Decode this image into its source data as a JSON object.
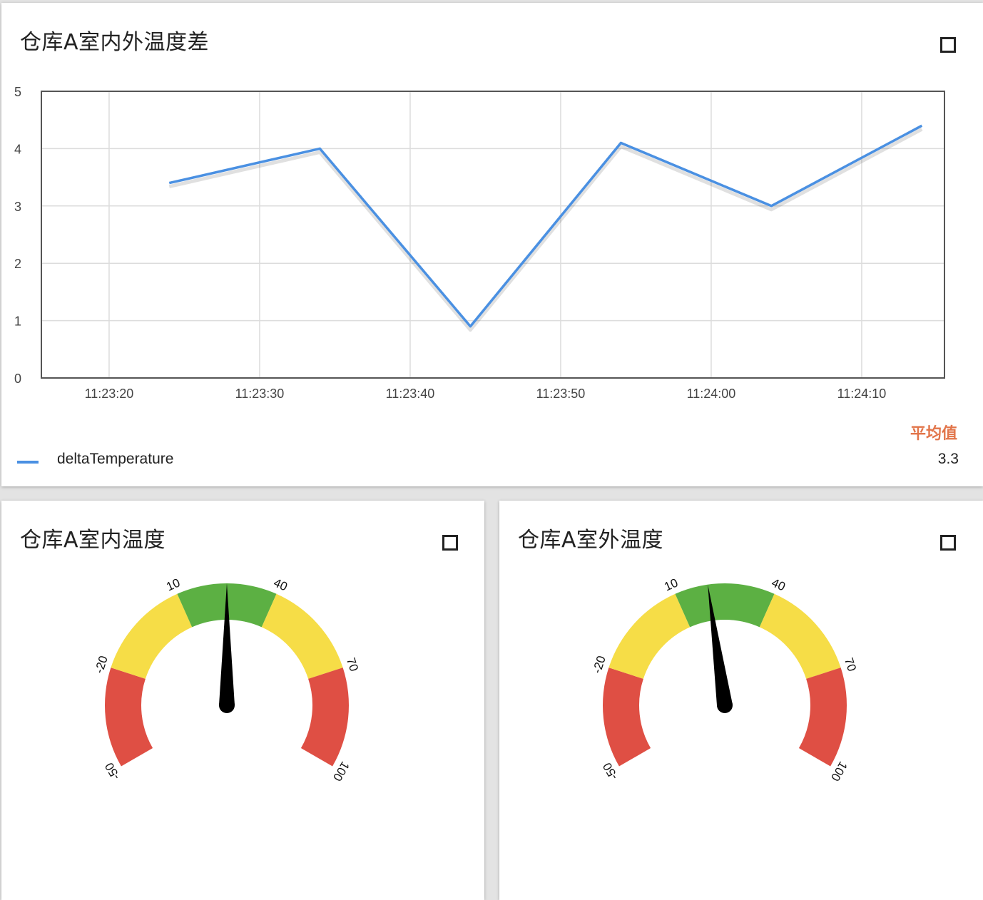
{
  "top_card": {
    "title": "仓库A室内外温度差",
    "fullscreen_icon": "fullscreen-icon",
    "avg_header": "平均值",
    "legend": [
      {
        "label": "deltaTemperature",
        "color": "#4a90e2",
        "avg": "3.3"
      }
    ]
  },
  "chart_data": {
    "type": "line",
    "title": "仓库A室内外温度差",
    "xlabel": "",
    "ylabel": "",
    "ylim": [
      0,
      5
    ],
    "yticks": [
      "0",
      "1",
      "2",
      "3",
      "4",
      "5"
    ],
    "xticks": [
      "11:23:20",
      "11:23:30",
      "11:23:40",
      "11:23:50",
      "11:24:00",
      "11:24:10"
    ],
    "xlim": [
      "11:23:15.5",
      "11:24:15.5"
    ],
    "grid": true,
    "series": [
      {
        "name": "deltaTemperature",
        "color": "#4a90e2",
        "x": [
          "11:23:24",
          "11:23:34",
          "11:23:44",
          "11:23:54",
          "11:24:04",
          "11:24:14"
        ],
        "y": [
          3.4,
          4.0,
          0.9,
          4.1,
          3.0,
          4.4
        ]
      }
    ]
  },
  "gauges": [
    {
      "title": "仓库A室内温度",
      "value": 25,
      "min": -50,
      "max": 100,
      "tick_labels": [
        "-50",
        "-20",
        "10",
        "40",
        "70",
        "100"
      ],
      "bands": [
        {
          "from": -50,
          "to": -20,
          "color": "#df4f44"
        },
        {
          "from": -20,
          "to": 10,
          "color": "#f6dd47"
        },
        {
          "from": 10,
          "to": 40,
          "color": "#5cb043"
        },
        {
          "from": 40,
          "to": 70,
          "color": "#f6dd47"
        },
        {
          "from": 70,
          "to": 100,
          "color": "#df4f44"
        }
      ]
    },
    {
      "title": "仓库A室外温度",
      "value": 20,
      "min": -50,
      "max": 100,
      "tick_labels": [
        "-50",
        "-20",
        "10",
        "40",
        "70",
        "100"
      ],
      "bands": [
        {
          "from": -50,
          "to": -20,
          "color": "#df4f44"
        },
        {
          "from": -20,
          "to": 10,
          "color": "#f6dd47"
        },
        {
          "from": 10,
          "to": 40,
          "color": "#5cb043"
        },
        {
          "from": 40,
          "to": 70,
          "color": "#f6dd47"
        },
        {
          "from": 70,
          "to": 100,
          "color": "#df4f44"
        }
      ]
    }
  ]
}
